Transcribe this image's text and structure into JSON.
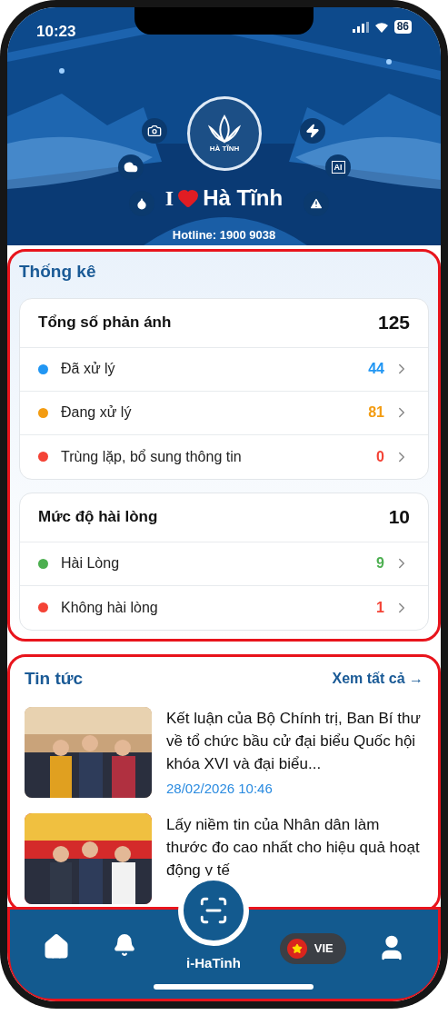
{
  "status_bar": {
    "time": "10:23",
    "battery": "86"
  },
  "banner": {
    "emblem_caption": "HÀ TĨNH",
    "title_start": "I",
    "title_end": "Hà Tĩnh",
    "hotline": "Hotline: 1900 9038",
    "ai_badge": "AI"
  },
  "statistics": {
    "title": "Thống kê",
    "groups": [
      {
        "title": "Tổng số phản ánh",
        "total": "125",
        "rows": [
          {
            "label": "Đã xử lý",
            "value": "44",
            "color": "#2196f3"
          },
          {
            "label": "Đang xử lý",
            "value": "81",
            "color": "#f39c12"
          },
          {
            "label": "Trùng lặp, bổ sung thông tin",
            "value": "0",
            "color": "#f44336"
          }
        ]
      },
      {
        "title": "Mức độ hài lòng",
        "total": "10",
        "rows": [
          {
            "label": "Hài Lòng",
            "value": "9",
            "color": "#4caf50"
          },
          {
            "label": "Không hài lòng",
            "value": "1",
            "color": "#f44336"
          }
        ]
      }
    ]
  },
  "news": {
    "title": "Tin tức",
    "see_all": "Xem tất cả →",
    "items": [
      {
        "title": "Kết luận của Bộ Chính trị, Ban Bí thư về tổ chức bầu cử đại biểu Quốc hội khóa XVI và đại biểu...",
        "date": "28/02/2026 10:46"
      },
      {
        "title": "Lấy niềm tin của Nhân dân làm thước đo cao nhất cho hiệu quả hoạt động y tế"
      }
    ]
  },
  "nav": [
    {
      "kind": "home"
    },
    {
      "kind": "notifications"
    },
    {
      "kind": "scan",
      "label": "i-HaTinh"
    },
    {
      "kind": "language",
      "label": "VIE"
    },
    {
      "kind": "profile"
    }
  ]
}
